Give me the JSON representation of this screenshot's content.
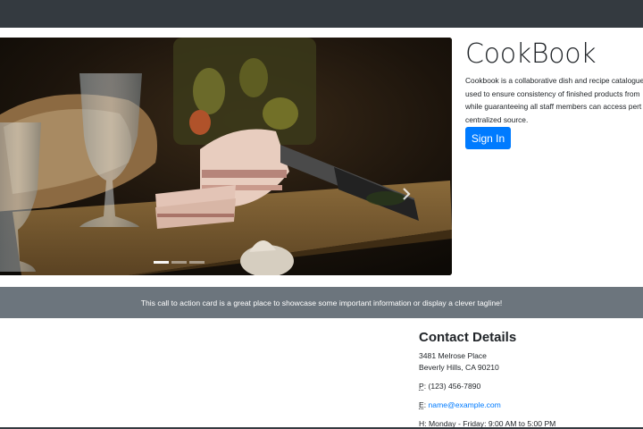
{
  "brand": {
    "title": "CookBook",
    "description_lines": [
      "Cookbook is a collaborative dish and recipe catalogue",
      "used to ensure consistency of finished products from",
      "while guaranteeing all staff members can access pert",
      "centralized source."
    ],
    "signin_label": "Sign In",
    "accent_color": "#007bff"
  },
  "carousel": {
    "next_icon": "chevron-right-icon",
    "indicators": [
      {
        "active": true
      },
      {
        "active": false
      },
      {
        "active": false
      }
    ]
  },
  "cta": {
    "text": "This call to action card is a great place to showcase some important information or display a clever tagline!"
  },
  "contact": {
    "title": "Contact Details",
    "address_line1": "3481 Melrose Place",
    "address_line2": "Beverly Hills, CA 90210",
    "phone_abbr": "P",
    "phone": "(123) 456-7890",
    "email_abbr": "E",
    "email": "name@example.com",
    "hours_abbr": "H",
    "hours": "Monday - Friday: 9:00 AM to 5:00 PM"
  }
}
